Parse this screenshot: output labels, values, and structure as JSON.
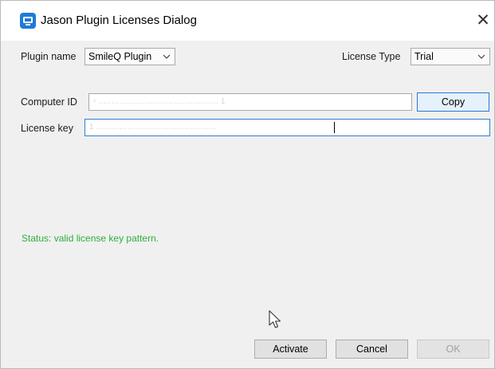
{
  "window": {
    "title": "Jason Plugin Licenses Dialog",
    "close_glyph": "✕"
  },
  "form": {
    "plugin_name_label": "Plugin name",
    "plugin_name_value": "SmileQ Plugin",
    "license_type_label": "License Type",
    "license_type_value": "Trial",
    "computer_id_label": "Computer ID",
    "computer_id_value": "▫ .............................................. 1",
    "copy_label": "Copy",
    "license_key_label": "License key",
    "license_key_value": "1 .............................................."
  },
  "status": {
    "text": "Status: valid license key pattern.",
    "color": "#2eae3c"
  },
  "footer": {
    "activate_label": "Activate",
    "cancel_label": "Cancel",
    "ok_label": "OK"
  },
  "icons": {
    "app": "plugin-app-icon",
    "close": "close-icon",
    "chevron": "chevron-down-icon",
    "cursor": "mouse-pointer-icon"
  },
  "colors": {
    "accent": "#2f7fd3",
    "status_green": "#2eae3c",
    "app_icon": "#1f7bd6"
  }
}
